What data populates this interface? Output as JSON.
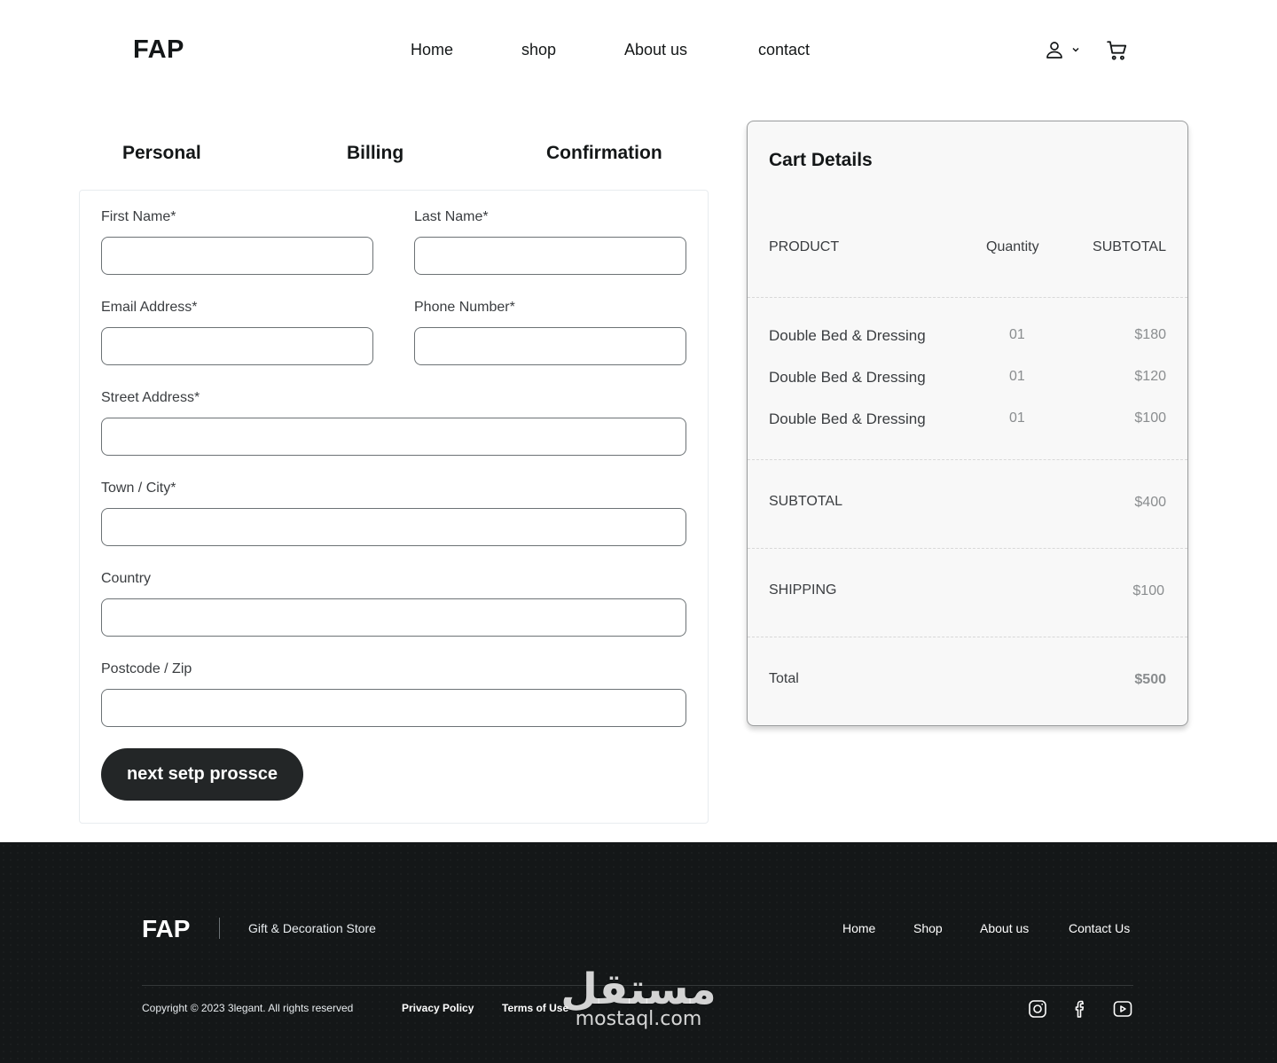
{
  "header": {
    "logo": "FAP",
    "nav": [
      "Home",
      "shop",
      "About us",
      "contact"
    ]
  },
  "steps": {
    "personal": "Personal",
    "billing": "Billing",
    "confirmation": "Confirmation"
  },
  "form": {
    "first_name_label": "First Name*",
    "last_name_label": "Last Name*",
    "email_label": "Email Address*",
    "phone_label": "Phone Number*",
    "street_label": "Street Address*",
    "city_label": "Town / City*",
    "country_label": "Country",
    "postcode_label": "Postcode / Zip",
    "first_name_value": "",
    "last_name_value": "",
    "email_value": "",
    "phone_value": "",
    "street_value": "",
    "city_value": "",
    "country_value": "",
    "postcode_value": "",
    "next_button": "next setp prossce"
  },
  "cart": {
    "title": "Cart Details",
    "headers": {
      "product": "PRODUCT",
      "quantity": "Quantity",
      "subtotal": "SUBTOTAL"
    },
    "items": [
      {
        "name": "Double Bed & Dressing",
        "qty": "01",
        "price": "$180"
      },
      {
        "name": "Double Bed & Dressing",
        "qty": "01",
        "price": "$120"
      },
      {
        "name": "Double Bed & Dressing",
        "qty": "01",
        "price": "$100"
      }
    ],
    "subtotal_label": "SUBTOTAL",
    "subtotal_value": "$400",
    "shipping_label": "SHIPPING",
    "shipping_value": "$100",
    "total_label": "Total",
    "total_value": "$500"
  },
  "footer": {
    "logo": "FAP",
    "tagline": "Gift & Decoration Store",
    "nav": [
      "Home",
      "Shop",
      "About us",
      "Contact Us"
    ],
    "copyright": "Copyright © 2023 3legant. All rights reserved",
    "privacy": "Privacy Policy",
    "terms": "Terms of Use",
    "social": [
      "instagram-icon",
      "facebook-icon",
      "youtube-icon"
    ]
  },
  "watermark": {
    "arabic": "مستقل",
    "latin": "mostaql.com"
  },
  "colors": {
    "primary_dark": "#141718",
    "button_dark": "#232627",
    "muted_text": "#8a8d8f",
    "cart_bg": "#f8f8f8"
  }
}
